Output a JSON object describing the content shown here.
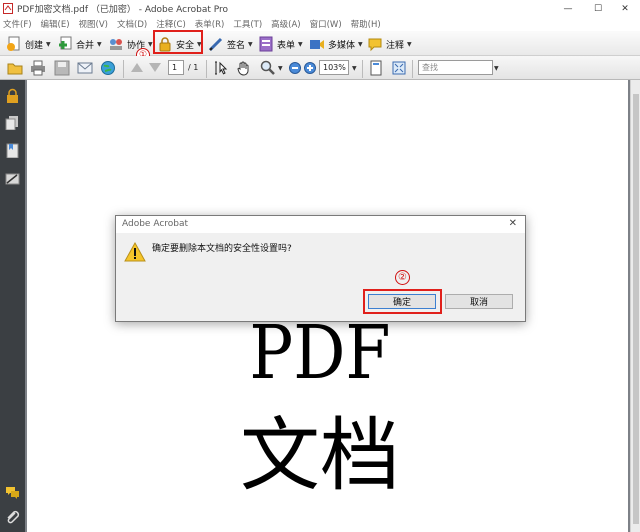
{
  "window": {
    "title": "PDF加密文档.pdf （已加密） - Adobe Acrobat Pro",
    "minimize": "—",
    "maximize": "☐",
    "close": "✕"
  },
  "menu": [
    "文件(F)",
    "编辑(E)",
    "视图(V)",
    "文档(D)",
    "注释(C)",
    "表单(R)",
    "工具(T)",
    "高级(A)",
    "窗口(W)",
    "帮助(H)"
  ],
  "toolbar1": {
    "create": "创建",
    "combine": "合并",
    "collaborate": "协作",
    "secure": "安全",
    "sign": "签名",
    "forms": "表单",
    "multimedia": "多媒体",
    "comment": "注释"
  },
  "toolbar2": {
    "current_page": "1",
    "total_pages": "/ 1",
    "zoom": "103%",
    "search_placeholder": "查找"
  },
  "annotations": {
    "step1": "①",
    "step2": "②",
    "color": "#e0201b"
  },
  "dialog": {
    "title": "Adobe Acrobat",
    "close": "✕",
    "message": "确定要删除本文档的安全性设置吗?",
    "ok": "确定",
    "cancel": "取消"
  },
  "document": {
    "line1": "PDF",
    "line2": "文档"
  },
  "icons": {
    "leftnav": [
      "lock-icon",
      "pages-icon",
      "bookmarks-icon",
      "signatures-icon",
      "comments-icon",
      "attachments-icon"
    ]
  }
}
